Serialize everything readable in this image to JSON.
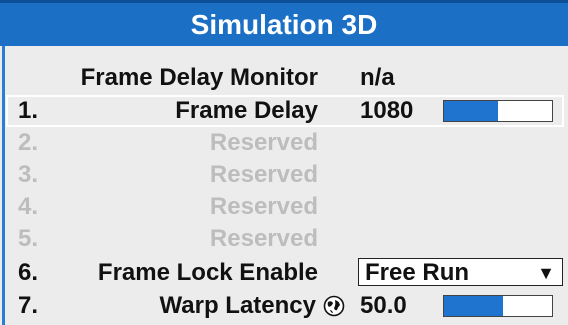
{
  "title": "Simulation 3D",
  "monitor": {
    "label": "Frame Delay Monitor",
    "value": "n/a"
  },
  "items": [
    {
      "num": "1.",
      "label": "Frame Delay",
      "value": "1080",
      "slider_fraction": 0.5,
      "enabled": true,
      "selected": true
    },
    {
      "num": "2.",
      "label": "Reserved",
      "enabled": false
    },
    {
      "num": "3.",
      "label": "Reserved",
      "enabled": false
    },
    {
      "num": "4.",
      "label": "Reserved",
      "enabled": false
    },
    {
      "num": "5.",
      "label": "Reserved",
      "enabled": false
    },
    {
      "num": "6.",
      "label": "Frame Lock Enable",
      "dropdown_value": "Free Run",
      "enabled": true
    },
    {
      "num": "7.",
      "label": "Warp Latency",
      "value": "50.0",
      "slider_fraction": 0.55,
      "icon": "globe-icon",
      "enabled": true
    }
  ],
  "colors": {
    "title_bar": "#1b6fc4",
    "accent": "#1f74cf",
    "disabled_text": "#bdbdbd"
  }
}
